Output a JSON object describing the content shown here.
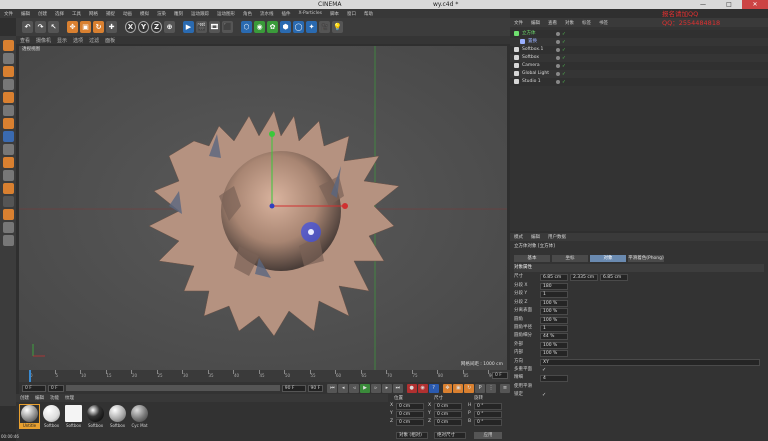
{
  "window": {
    "title": "CINEMA",
    "file_title": "wy.c4d *",
    "min": "—",
    "max": "□",
    "close": "✕"
  },
  "menubar": {
    "items": [
      "文件",
      "编辑",
      "创建",
      "选择",
      "工具",
      "网格",
      "捕捉",
      "动画",
      "模拟",
      "渲染",
      "雕刻",
      "运动跟踪",
      "运动图形",
      "角色",
      "流水线",
      "插件",
      "X-Particles",
      "脚本",
      "窗口",
      "帮助"
    ]
  },
  "toolbar": {
    "buttons": [
      "↶",
      "↷",
      "↖",
      "✥",
      "▣",
      "↻",
      "✚",
      "X",
      "Y",
      "Z",
      "⊕",
      "▶",
      "🎬",
      "🎞",
      "⬛",
      "⬡",
      "◉",
      "✿",
      "⬢",
      "◯",
      "✦",
      "🎥",
      "💡"
    ]
  },
  "viewport": {
    "menu": [
      "查看",
      "摄像机",
      "显示",
      "选项",
      "过滤",
      "面板"
    ],
    "label": "透视视图",
    "grid_spacing": "网格间距 : 1000 cm"
  },
  "timeline": {
    "ticks": [
      "0",
      "5",
      "10",
      "15",
      "20",
      "25",
      "30",
      "35",
      "40",
      "45",
      "50",
      "55",
      "60",
      "65",
      "70",
      "75",
      "80",
      "85",
      "90"
    ],
    "frame_readout": "0 F"
  },
  "transport": {
    "start": "0 F",
    "start2": "0 F",
    "end": "90 F",
    "end2": "90 F"
  },
  "materials": {
    "menu": [
      "创建",
      "编辑",
      "功能",
      "纹理"
    ],
    "items": [
      {
        "label": "Untitle"
      },
      {
        "label": "Softbox"
      },
      {
        "label": "Softbox"
      },
      {
        "label": "Softbox"
      },
      {
        "label": "Softbox"
      },
      {
        "label": "Cyc Mat"
      }
    ]
  },
  "coords": {
    "headers": [
      "位置",
      "尺寸",
      "旋转"
    ],
    "rows": [
      {
        "axis": "X",
        "pos": "0 cm",
        "size": "0 cm",
        "rot_axis": "H",
        "rot": "0 °"
      },
      {
        "axis": "Y",
        "pos": "0 cm",
        "size": "0 cm",
        "rot_axis": "P",
        "rot": "0 °"
      },
      {
        "axis": "Z",
        "pos": "0 cm",
        "size": "0 cm",
        "rot_axis": "B",
        "rot": "0 °"
      }
    ],
    "mode": "对象 (相对)",
    "size_mode": "绝对尺寸",
    "apply": "应用"
  },
  "objects": {
    "menu": [
      "文件",
      "编辑",
      "查看",
      "对象",
      "标签",
      "书签"
    ],
    "rows": [
      {
        "name": "立方体",
        "color": "#6fe06f",
        "indent": 0
      },
      {
        "name": "置换",
        "color": "#9ab0ff",
        "indent": 1
      },
      {
        "name": "Softbox.1",
        "color": "#d8d8d8",
        "indent": 0
      },
      {
        "name": "Softbox",
        "color": "#d8d8d8",
        "indent": 0
      },
      {
        "name": "Camera",
        "color": "#d8d8d8",
        "indent": 0
      },
      {
        "name": "Global Light",
        "color": "#d8d8d8",
        "indent": 0
      },
      {
        "name": "Studio 1",
        "color": "#d8d8d8",
        "indent": 0
      }
    ]
  },
  "watermark": {
    "line1": "报名请加QQ",
    "line2": "QQ：2554484818"
  },
  "attributes": {
    "menu": [
      "模式",
      "编辑",
      "用户数据"
    ],
    "object_title": "立方体对象 [立方体]",
    "tabs": [
      "基本",
      "坐标",
      "对象",
      "平滑着色(Phong)"
    ],
    "section": "对象属性",
    "size_label": "尺寸",
    "size_x": "6.85 cm",
    "size_y": "2.335 cm",
    "size_z": "6.85 cm",
    "rows": [
      {
        "label": "分段 X",
        "value": "180"
      },
      {
        "label": "分段 Y",
        "value": "1"
      },
      {
        "label": "分段 Z",
        "value": "100 %"
      },
      {
        "label": "分离表面",
        "value": "100 %"
      },
      {
        "label": "圆角",
        "value": "100 %"
      },
      {
        "label": "圆角半径",
        "value": "1"
      },
      {
        "label": "圆角细分",
        "value": "44 %"
      },
      {
        "label": "外部",
        "value": "100 %"
      },
      {
        "label": "内部",
        "value": "100 %"
      },
      {
        "label": "方向",
        "value": "XY"
      },
      {
        "label": "多重平面",
        "value": "✓"
      },
      {
        "label": "精细",
        "value": "4"
      },
      {
        "label": "使用平滑",
        "value": ""
      },
      {
        "label": "锁定",
        "value": "✓"
      }
    ]
  },
  "status": {
    "time": "00:00:46"
  },
  "colors": {
    "accent": "#e8a030",
    "axis_green": "#3aa83a",
    "axis_red": "#d03030",
    "cursor": "#4050e0"
  }
}
